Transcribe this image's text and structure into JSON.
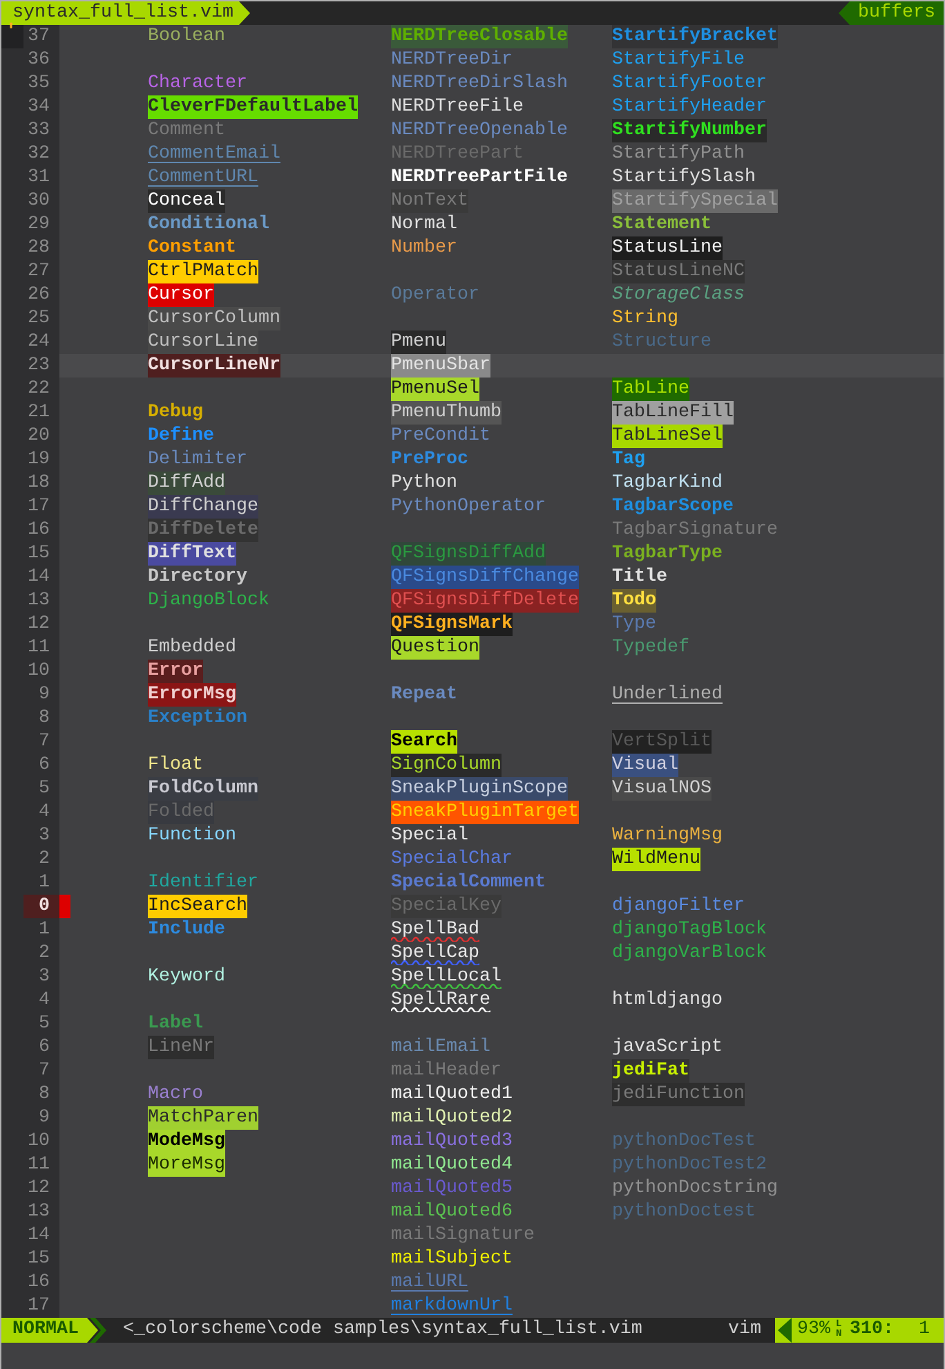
{
  "tabline": {
    "file": "syntax_full_list.vim",
    "buffers": "buffers"
  },
  "rows": [
    {
      "number": "37",
      "sign": "'",
      "column_1": {
        "text": "Boolean",
        "color": "#9aaf5f"
      },
      "column_2": {
        "text": "NERDTreeClosable",
        "color": "#5fb000",
        "background": {
          "color": "#3a5a3a"
        },
        "bold": true
      },
      "column_3": {
        "text": "StartifyBracket",
        "color": "#1e8fe0",
        "background": {
          "color": "#333335"
        },
        "bold": true
      }
    },
    {
      "number": "36",
      "column_2": {
        "text": "NERDTreeDir",
        "color": "#6a8ac0"
      },
      "column_3": {
        "text": "StartifyFile",
        "color": "#1ea0f0"
      }
    },
    {
      "number": "35",
      "column_1": {
        "text": "Character",
        "color": "#b864e6"
      },
      "column_2": {
        "text": "NERDTreeDirSlash",
        "color": "#6a8ac0"
      },
      "column_3": {
        "text": "StartifyFooter",
        "color": "#1ea0f0"
      }
    },
    {
      "number": "34",
      "column_1": {
        "text": "CleverFDefaultLabel",
        "color": "#2a2a2a",
        "background": {
          "color": "#66dd00"
        },
        "bold": true
      },
      "column_2": {
        "text": "NERDTreeFile",
        "color": "#e0e0e0"
      },
      "column_3": {
        "text": "StartifyHeader",
        "color": "#1ea0f0"
      }
    },
    {
      "number": "33",
      "column_1": {
        "text": "Comment",
        "color": "#7a7a7a"
      },
      "column_2": {
        "text": "NERDTreeOpenable",
        "color": "#6a8ac0"
      },
      "column_3": {
        "text": "StartifyNumber",
        "color": "#30e020",
        "background": {
          "color": "#2a2a2a"
        },
        "bold": true
      }
    },
    {
      "number": "32",
      "column_1": {
        "text": "CommentEmail",
        "color": "#5f87af",
        "underline": true
      },
      "column_2": {
        "text": "NERDTreePart",
        "color": "#6a6a6a"
      },
      "column_3": {
        "text": "StartifyPath",
        "color": "#909090"
      }
    },
    {
      "number": "31",
      "column_1": {
        "text": "CommentURL",
        "color": "#5f87af",
        "underline": true
      },
      "column_2": {
        "text": "NERDTreePartFile",
        "color": "#ffffff",
        "bold": true
      },
      "column_3": {
        "text": "StartifySlash",
        "color": "#e0e0e0"
      }
    },
    {
      "number": "30",
      "column_1": {
        "text": "Conceal",
        "color": "#ffffff",
        "background": {
          "color": "#2b2b2b"
        }
      },
      "column_2": {
        "text": "NonText",
        "color": "#7a7a7a",
        "background": {
          "color": "#3a3a3a"
        }
      },
      "column_3": {
        "text": "StartifySpecial",
        "color": "#a0a0a0",
        "background": {
          "color": "#6a6a6a"
        }
      }
    },
    {
      "number": "29",
      "column_1": {
        "text": "Conditional",
        "color": "#6b9ac7",
        "bold": true
      },
      "column_2": {
        "text": "Normal",
        "color": "#e0e0e0"
      },
      "column_3": {
        "text": "Statement",
        "color": "#8abf3a",
        "bold": true
      }
    },
    {
      "number": "28",
      "column_1": {
        "text": "Constant",
        "color": "#ff9f00",
        "bold": true
      },
      "column_2": {
        "text": "Number",
        "color": "#e89a4a"
      },
      "column_3": {
        "text": "StatusLine",
        "color": "#f0f0f0",
        "background": {
          "color": "#1e1e1e"
        }
      }
    },
    {
      "number": "27",
      "column_1": {
        "text": "CtrlPMatch",
        "color": "#1c1c1c",
        "background": {
          "color": "#ffcc00"
        }
      },
      "column_3": {
        "text": "StatusLineNC",
        "color": "#7a7a7a",
        "background": {
          "color": "#333333"
        }
      }
    },
    {
      "number": "26",
      "column_1": {
        "text": "Cursor",
        "color": "#ffffff",
        "background": {
          "color": "#dd0000"
        }
      },
      "column_2": {
        "text": "Operator",
        "color": "#5a7a9a"
      },
      "column_3": {
        "text": "StorageClass",
        "color": "#5aa080",
        "italic": true
      }
    },
    {
      "number": "25",
      "column_1": {
        "text": "CursorColumn",
        "color": "#c0c0c0",
        "background": {
          "color": "#4a4a4a"
        }
      },
      "column_3": {
        "text": "String",
        "color": "#ffc030"
      }
    },
    {
      "number": "24",
      "column_1": {
        "text": "CursorLine",
        "color": "#c0c0c0",
        "background": {
          "color": "#474747"
        }
      },
      "column_2": {
        "text": "Pmenu",
        "color": "#d0d0d0",
        "background": {
          "color": "#2a2a2a"
        }
      },
      "column_3": {
        "text": "Structure",
        "color": "#4a6a8a"
      }
    },
    {
      "number": "23",
      "highlighted": true,
      "column_1": {
        "text": "CursorLineNr",
        "color": "#f0e0e0",
        "background": {
          "color": "#4f1f1f"
        },
        "bold": true
      },
      "column_2": {
        "text": "PmenuSbar",
        "color": "#e4e4e4",
        "background": {
          "color": "#8a8a8a"
        }
      }
    },
    {
      "number": "22",
      "column_2": {
        "text": "PmenuSel",
        "color": "#1a1a1a",
        "background": {
          "color": "#a8d82a"
        }
      },
      "column_3": {
        "text": "TabLine",
        "color": "#a8e000",
        "background": {
          "color": "#1f6a00"
        }
      }
    },
    {
      "number": "21",
      "column_1": {
        "text": "Debug",
        "color": "#d7af00",
        "bold": true
      },
      "column_2": {
        "text": "PmenuThumb",
        "color": "#d0d0d0",
        "background": {
          "color": "#555555"
        }
      },
      "column_3": {
        "text": "TabLineFill",
        "color": "#2a2a2a",
        "background": {
          "color": "#a0a0a0"
        }
      }
    },
    {
      "number": "20",
      "column_1": {
        "text": "Define",
        "color": "#1e90ff",
        "bold": true
      },
      "column_2": {
        "text": "PreCondit",
        "color": "#6a8ac0"
      },
      "column_3": {
        "text": "TabLineSel",
        "color": "#2a2a2a",
        "background": {
          "color": "#a8d800"
        }
      }
    },
    {
      "number": "19",
      "column_1": {
        "text": "Delimiter",
        "color": "#6a8bc0"
      },
      "column_2": {
        "text": "PreProc",
        "color": "#2d8be0",
        "bold": true
      },
      "column_3": {
        "text": "Tag",
        "color": "#1ea0f0",
        "bold": true
      }
    },
    {
      "number": "18",
      "column_1": {
        "text": "DiffAdd",
        "color": "#d0d0d0",
        "background": {
          "color": "#3a4a3a"
        }
      },
      "column_2": {
        "text": "Python",
        "color": "#e0e0e0"
      },
      "column_3": {
        "text": "TagbarKind",
        "color": "#c0e0f0"
      }
    },
    {
      "number": "17",
      "column_1": {
        "text": "DiffChange",
        "color": "#d0d0d0",
        "background": {
          "color": "#3a3a50"
        }
      },
      "column_2": {
        "text": "PythonOperator",
        "color": "#6a8ac0"
      },
      "column_3": {
        "text": "TagbarScope",
        "color": "#1e8fe0",
        "bold": true
      }
    },
    {
      "number": "16",
      "column_1": {
        "text": "DiffDelete",
        "color": "#6a6a6a",
        "background": {
          "color": "#333333"
        },
        "bold": true
      },
      "column_3": {
        "text": "TagbarSignature",
        "color": "#7a7a7a"
      }
    },
    {
      "number": "15",
      "column_1": {
        "text": "DiffText",
        "color": "#e0e0e0",
        "background": {
          "color": "#4a4aa0"
        },
        "bold": true
      },
      "column_2": {
        "text": "QFSignsDiffAdd",
        "color": "#2a9a40",
        "background": {
          "color": "#30483a"
        }
      },
      "column_3": {
        "text": "TagbarType",
        "color": "#7ab020",
        "bold": true
      }
    },
    {
      "number": "14",
      "column_1": {
        "text": "Directory",
        "color": "#c8c8c8",
        "bold": true
      },
      "column_2": {
        "text": "QFSignsDiffChange",
        "color": "#4a8ae0",
        "background": {
          "color": "#2a4a8a"
        }
      },
      "column_3": {
        "text": "Title",
        "color": "#e0e0e0",
        "bold": true
      }
    },
    {
      "number": "13",
      "column_1": {
        "text": "DjangoBlock",
        "color": "#2db34a"
      },
      "column_2": {
        "text": "QFSignsDiffDelete",
        "color": "#e05050",
        "background": {
          "color": "#8a2222"
        }
      },
      "column_3": {
        "text": "Todo",
        "color": "#ffe040",
        "background": {
          "color": "#6a6030"
        },
        "bold": true
      }
    },
    {
      "number": "12",
      "column_2": {
        "text": "QFSignsMark",
        "color": "#ffb020",
        "background": {
          "color": "#1e1e1e"
        },
        "bold": true
      },
      "column_3": {
        "text": "Type",
        "color": "#5a7ab0"
      }
    },
    {
      "number": "11",
      "column_1": {
        "text": "Embedded",
        "color": "#d0d0d0"
      },
      "column_2": {
        "text": "Question",
        "color": "#1a1a1a",
        "background": {
          "color": "#a8d82a"
        }
      },
      "column_3": {
        "text": "Typedef",
        "color": "#4a9a70"
      }
    },
    {
      "number": "10",
      "column_1": {
        "text": "Error",
        "color": "#e8a0a0",
        "background": {
          "color": "#5a1e1e"
        },
        "bold": true
      }
    },
    {
      "number": "9",
      "column_1": {
        "text": "ErrorMsg",
        "color": "#f0d0d0",
        "background": {
          "color": "#8b1515"
        },
        "bold": true
      },
      "column_2": {
        "text": "Repeat",
        "color": "#6a8ac0",
        "bold": true
      },
      "column_3": {
        "text": "Underlined",
        "color": "#b0b0b0",
        "underline": true
      }
    },
    {
      "number": "8",
      "column_1": {
        "text": "Exception",
        "color": "#2a80c8",
        "bold": true
      }
    },
    {
      "number": "7",
      "column_2": {
        "text": "Search",
        "color": "#000000",
        "background": {
          "color": "#b8e000"
        },
        "bold": true
      },
      "column_3": {
        "text": "VertSplit",
        "color": "#5a5a5a",
        "background": {
          "color": "#222222"
        }
      }
    },
    {
      "number": "6",
      "column_1": {
        "text": "Float",
        "color": "#f0e68c"
      },
      "column_2": {
        "text": "SignColumn",
        "color": "#a8d82a",
        "background": {
          "color": "#2a2a2a"
        }
      },
      "column_3": {
        "text": "Visual",
        "color": "#d0d0e0",
        "background": {
          "color": "#3a5080"
        }
      }
    },
    {
      "number": "5",
      "column_1": {
        "text": "FoldColumn",
        "color": "#c8c8d0",
        "background": {
          "color": "#3a3d44"
        },
        "bold": true
      },
      "column_2": {
        "text": "SneakPluginScope",
        "color": "#c8d0e0",
        "background": {
          "color": "#3a4a6a"
        }
      },
      "column_3": {
        "text": "VisualNOS",
        "color": "#d0d0d0",
        "background": {
          "color": "#4a4a4a"
        }
      }
    },
    {
      "number": "4",
      "column_1": {
        "text": "Folded",
        "color": "#6a6a6a",
        "background": {
          "color": "#383a40"
        }
      },
      "column_2": {
        "text": "SneakPluginTarget",
        "color": "#ffd000",
        "background": {
          "color": "#ff5500"
        }
      }
    },
    {
      "number": "3",
      "column_1": {
        "text": "Function",
        "color": "#87d7ff"
      },
      "column_2": {
        "text": "Special",
        "color": "#e8e8e8"
      },
      "column_3": {
        "text": "WarningMsg",
        "color": "#e8b040"
      }
    },
    {
      "number": "2",
      "column_2": {
        "text": "SpecialChar",
        "color": "#5a7ae0"
      },
      "column_3": {
        "text": "WildMenu",
        "color": "#1a1a1a",
        "background": {
          "color": "#b8e000"
        }
      }
    },
    {
      "number": "1",
      "column_1": {
        "text": "Identifier",
        "color": "#20a8a0"
      },
      "column_2": {
        "text": "SpecialComment",
        "color": "#5a7ad0",
        "bold": true
      }
    },
    {
      "number": "0",
      "current": true,
      "column_1": {
        "text": "IncSearch",
        "color": "#1c1c1c",
        "background": {
          "color": "#ffcc00"
        }
      },
      "column_2": {
        "text": "SpecialKey",
        "color": "#6a6a6a",
        "background": {
          "color": "#3a3a3a"
        }
      },
      "column_3": {
        "text": "djangoFilter",
        "color": "#5a8ae0"
      }
    },
    {
      "number": "1",
      "column_1": {
        "text": "Include",
        "color": "#2d8be0",
        "bold": true
      },
      "column_2": {
        "text": "SpellBad",
        "color": "#e8e8e8",
        "undercurl": {
          "color": "#e03030"
        }
      },
      "column_3": {
        "text": "djangoTagBlock",
        "color": "#2db34a"
      }
    },
    {
      "number": "2",
      "column_2": {
        "text": "SpellCap",
        "color": "#e8e8e8",
        "undercurl": {
          "color": "#4060ff"
        }
      },
      "column_3": {
        "text": "djangoVarBlock",
        "color": "#2db34a"
      }
    },
    {
      "number": "3",
      "column_1": {
        "text": "Keyword",
        "color": "#b0f0e0"
      },
      "column_2": {
        "text": "SpellLocal",
        "color": "#e8e8e8",
        "undercurl": {
          "color": "#40c040"
        }
      }
    },
    {
      "number": "4",
      "column_2": {
        "text": "SpellRare",
        "color": "#e8e8e8",
        "undercurl": {
          "color": "#ffffff"
        }
      },
      "column_3": {
        "text": "htmldjango",
        "color": "#e0e0e0"
      }
    },
    {
      "number": "5",
      "column_1": {
        "text": "Label",
        "color": "#3a9a50",
        "bold": true
      }
    },
    {
      "number": "6",
      "column_1": {
        "text": "LineNr",
        "color": "#7a7a7a",
        "background": {
          "color": "#2e2e2e"
        }
      },
      "column_2": {
        "text": "mailEmail",
        "color": "#6a8ab0"
      },
      "column_3": {
        "text": "javaScript",
        "color": "#e0e0e0"
      }
    },
    {
      "number": "7",
      "column_2": {
        "text": "mailHeader",
        "color": "#7a7a7a"
      },
      "column_3": {
        "text": "jediFat",
        "color": "#c8f000",
        "background": {
          "color": "#333333"
        },
        "bold": true
      }
    },
    {
      "number": "8",
      "column_1": {
        "text": "Macro",
        "color": "#9a80d0"
      },
      "column_2": {
        "text": "mailQuoted1",
        "color": "#f0f0f0"
      },
      "column_3": {
        "text": "jediFunction",
        "color": "#7a7a7a",
        "background": {
          "color": "#2e2e2e"
        }
      }
    },
    {
      "number": "9",
      "column_1": {
        "text": "MatchParen",
        "color": "#2a2a2a",
        "background": {
          "color": "#a0d030"
        }
      },
      "column_2": {
        "text": "mailQuoted2",
        "color": "#e0f0b0"
      }
    },
    {
      "number": "10",
      "column_1": {
        "text": "ModeMsg",
        "color": "#000000",
        "background": {
          "color": "#a8d82a"
        },
        "bold": true
      },
      "column_2": {
        "text": "mailQuoted3",
        "color": "#8a70e0"
      },
      "column_3": {
        "text": "pythonDocTest",
        "color": "#4a6a8a"
      }
    },
    {
      "number": "11",
      "column_1": {
        "text": "MoreMsg",
        "color": "#1a2a00",
        "background": {
          "color": "#a8d82a"
        }
      },
      "column_2": {
        "text": "mailQuoted4",
        "color": "#90e890"
      },
      "column_3": {
        "text": "pythonDocTest2",
        "color": "#4a6a8a"
      }
    },
    {
      "number": "12",
      "column_2": {
        "text": "mailQuoted5",
        "color": "#6a5ad0"
      },
      "column_3": {
        "text": "pythonDocstring",
        "color": "#909090"
      }
    },
    {
      "number": "13",
      "column_2": {
        "text": "mailQuoted6",
        "color": "#5ac050"
      },
      "column_3": {
        "text": "pythonDoctest",
        "color": "#4a6a8a"
      }
    },
    {
      "number": "14",
      "column_2": {
        "text": "mailSignature",
        "color": "#7a7a7a"
      }
    },
    {
      "number": "15",
      "column_2": {
        "text": "mailSubject",
        "color": "#f0f000"
      }
    },
    {
      "number": "16",
      "column_2": {
        "text": "mailURL",
        "color": "#5a7ab0",
        "underline": true
      }
    },
    {
      "number": "17",
      "column_2": {
        "text": "markdownUrl",
        "color": "#2080e0",
        "underline": true
      }
    }
  ],
  "status_bar": {
    "mode": "NORMAL",
    "path": "<_colorscheme\\code samples\\syntax_full_list.vim",
    "filetype": "vim",
    "percent": "93%",
    "line_symbol": "LN",
    "line": "310:",
    "column": "1"
  }
}
